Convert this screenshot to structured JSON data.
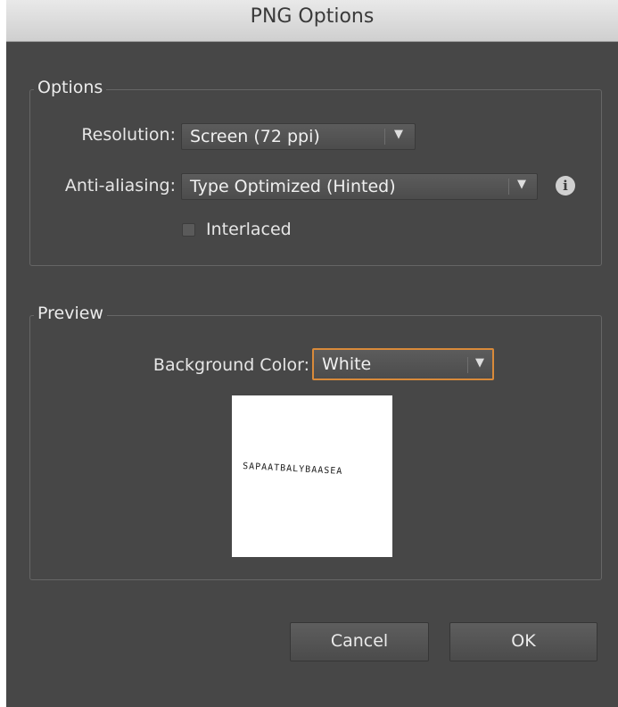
{
  "dialog": {
    "title": "PNG Options"
  },
  "options_group": {
    "legend": "Options",
    "resolution": {
      "label": "Resolution:",
      "value": "Screen (72 ppi)"
    },
    "anti_aliasing": {
      "label": "Anti-aliasing:",
      "value": "Type Optimized (Hinted)"
    },
    "interlaced": {
      "label": "Interlaced",
      "checked": false
    }
  },
  "preview_group": {
    "legend": "Preview",
    "background_color": {
      "label": "Background Color:",
      "value": "White"
    }
  },
  "buttons": {
    "cancel": "Cancel",
    "ok": "OK"
  },
  "icons": {
    "info": "info-icon",
    "dropdown": "chevron-down-icon"
  },
  "colors": {
    "dialog_bg": "#474747",
    "focus_accent": "#d98a3a",
    "preview_bg": "#ffffff"
  }
}
